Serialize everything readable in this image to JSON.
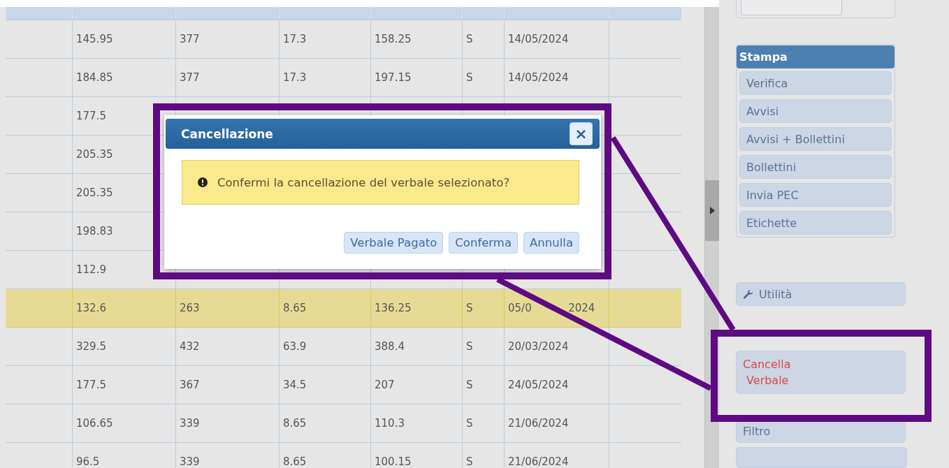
{
  "table": {
    "rows": [
      {
        "cells": [
          "145.95",
          "377",
          "17.3",
          "158.25",
          "S",
          "14/05/2024"
        ],
        "selected": false
      },
      {
        "cells": [
          "184.85",
          "377",
          "17.3",
          "197.15",
          "S",
          "14/05/2024"
        ],
        "selected": false
      },
      {
        "cells": [
          "177.5"
        ],
        "selected": false
      },
      {
        "cells": [
          "205.35"
        ],
        "selected": false
      },
      {
        "cells": [
          "205.35"
        ],
        "selected": false
      },
      {
        "cells": [
          "198.83"
        ],
        "selected": false
      },
      {
        "cells": [
          "112.9"
        ],
        "selected": false
      },
      {
        "cells": [
          "132.6",
          "263",
          "8.65",
          "136.25",
          "S",
          "05/0           2024"
        ],
        "selected": true
      },
      {
        "cells": [
          "329.5",
          "432",
          "63.9",
          "388.4",
          "S",
          "20/03/2024"
        ],
        "selected": false
      },
      {
        "cells": [
          "177.5",
          "367",
          "34.5",
          "207",
          "S",
          "24/05/2024"
        ],
        "selected": false
      },
      {
        "cells": [
          "106.65",
          "339",
          "8.65",
          "110.3",
          "S",
          "21/06/2024"
        ],
        "selected": false
      },
      {
        "cells": [
          "96.5",
          "339",
          "8.65",
          "100.15",
          "S",
          "21/06/2024"
        ],
        "selected": false
      }
    ]
  },
  "dialog": {
    "title": "Cancellazione",
    "close": "×",
    "message": "Confermi la cancellazione del verbale selezionato?",
    "buttons": [
      "Verbale Pagato",
      "Conferma",
      "Annulla"
    ]
  },
  "sidebar": {
    "print_group": {
      "title": "Stampa",
      "items": [
        "Verifica",
        "Avvisi",
        "Avvisi + Bollettini",
        "Bollettini",
        "Invia PEC",
        "Etichette"
      ]
    },
    "actions": [
      {
        "kind": "tool",
        "label": "Utilità"
      },
      {
        "kind": "danger",
        "label": "Cancella\n Verbale"
      },
      {
        "kind": "plain",
        "label": "Filtro"
      }
    ]
  }
}
